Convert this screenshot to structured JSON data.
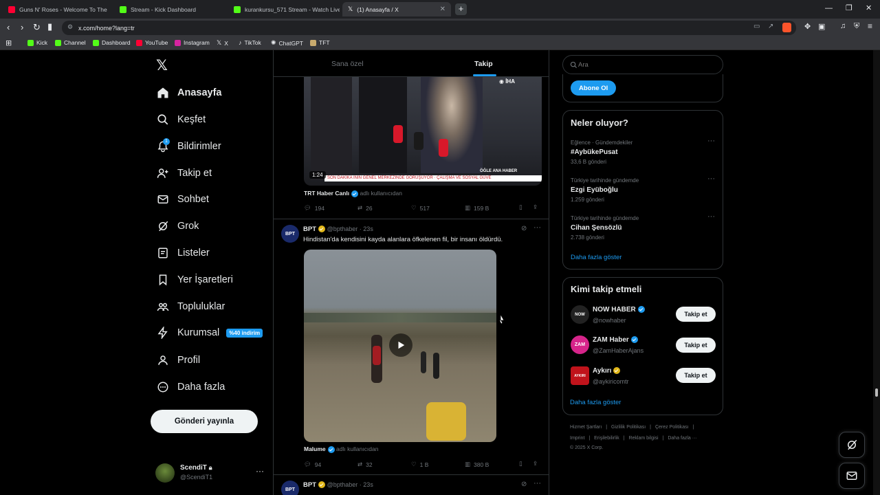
{
  "browser": {
    "tabs": [
      {
        "title": "Guns N' Roses - Welcome To The",
        "favicon_color": "#ff0033",
        "active": false
      },
      {
        "title": "Stream - Kick Dashboard",
        "favicon_color": "#53fc18",
        "active": false
      },
      {
        "title": "kurankursu_571 Stream - Watch Live",
        "favicon_color": "#53fc18",
        "active": false
      },
      {
        "title": "(1) Anasayfa / X",
        "favicon_color": "#ffffff",
        "active": true
      }
    ],
    "new_tab": "+",
    "url": "x.com/home?lang=tr",
    "bookmarks": [
      {
        "label": "Kick",
        "color": "#53fc18"
      },
      {
        "label": "Channel",
        "color": "#53fc18"
      },
      {
        "label": "Dashboard",
        "color": "#53fc18"
      },
      {
        "label": "YouTube",
        "color": "#ff0033"
      },
      {
        "label": "Instagram",
        "color": "#d6249f"
      },
      {
        "label": "X",
        "color": "#ffffff"
      },
      {
        "label": "TikTok",
        "color": "#25f4ee"
      },
      {
        "label": "ChatGPT",
        "color": "#cccccc"
      },
      {
        "label": "TFT",
        "color": "#c8aa6e"
      }
    ]
  },
  "sidebar": {
    "logo": "X",
    "items": [
      {
        "label": "Anasayfa",
        "icon": "home-icon"
      },
      {
        "label": "Keşfet",
        "icon": "search-icon"
      },
      {
        "label": "Bildirimler",
        "icon": "bell-icon",
        "count": "1"
      },
      {
        "label": "Takip et",
        "icon": "follow-icon"
      },
      {
        "label": "Sohbet",
        "icon": "mail-icon"
      },
      {
        "label": "Grok",
        "icon": "grok-icon"
      },
      {
        "label": "Listeler",
        "icon": "list-icon"
      },
      {
        "label": "Yer İşaretleri",
        "icon": "bookmark-icon"
      },
      {
        "label": "Topluluklar",
        "icon": "communities-icon"
      },
      {
        "label": "Kurumsal",
        "icon": "lightning-icon",
        "badge": "%40 indirim"
      },
      {
        "label": "Profil",
        "icon": "person-icon"
      },
      {
        "label": "Daha fazla",
        "icon": "more-circle-icon"
      }
    ],
    "post_button": "Gönderi yayınla",
    "account": {
      "name": "ScendiT",
      "handle": "@ScendiT1",
      "more": "···"
    }
  },
  "feed": {
    "tabs": [
      "Sana özel",
      "Takip"
    ],
    "active_tab": "Takip",
    "post1": {
      "duration": "1:24",
      "ticker": "SON DAKİKA ININ GENEL MERKEZİNDE GÖRÜŞÜYOR · ÇALIŞMA VE SOSYAL GÜVE",
      "overlay": "ÖĞLE ANA HABER",
      "source_name": "TRT Haber Canlı",
      "source_note": "adlı kullanıcıdan",
      "stats": {
        "replies": "194",
        "reposts": "26",
        "likes": "517",
        "views": "159 B"
      }
    },
    "post2": {
      "author": "BPT",
      "handle": "@bpthaber · 23s",
      "text": "Hindistan'da kendisini kayda alanlara öfkelenen fil, bir insanı öldürdü.",
      "source_name": "Malume",
      "source_note": "adlı kullanıcıdan",
      "stats": {
        "replies": "94",
        "reposts": "32",
        "likes": "1 B",
        "views": "380 B"
      }
    },
    "post3": {
      "author": "BPT",
      "handle": "@bpthaber · 23s"
    }
  },
  "right": {
    "search_placeholder": "Ara",
    "subscribe": "Abone Ol",
    "trends_title": "Neler oluyor?",
    "trends": [
      {
        "category": "Eğlence · Gündemdekiler",
        "title": "#AybükePusat",
        "count": "33,6 B gönderi"
      },
      {
        "category": "Türkiye tarihinde gündemde",
        "title": "Ezgi Eyüboğlu",
        "count": "1.259 gönderi"
      },
      {
        "category": "Türkiye tarihinde gündemde",
        "title": "Cihan Şensözlü",
        "count": "2.738 gönderi"
      }
    ],
    "trends_more": "Daha fazla göster",
    "who_title": "Kimi takip etmeli",
    "who": [
      {
        "name": "NOW HABER",
        "handle": "@nowhaber",
        "avatar": "NOW",
        "avatar_bg": "#222222",
        "button": "Takip et"
      },
      {
        "name": "ZAM Haber",
        "handle": "@ZamHaberAjans",
        "avatar": "ZAM",
        "avatar_bg": "#d6248a",
        "button": "Takip et"
      },
      {
        "name": "Aykırı",
        "handle": "@aykiricomtr",
        "avatar": "AYKIRI",
        "avatar_bg": "#c0131b",
        "button": "Takip et"
      }
    ],
    "who_more": "Daha fazla göster",
    "footer": {
      "line1": [
        "Hizmet Şartları",
        "Gizlilik Politikası",
        "Çerez Politikası"
      ],
      "line2": [
        "Imprint",
        "Erişilebilirlik",
        "Reklam bilgisi",
        "Daha fazla ···"
      ],
      "copyright": "© 2025 X Corp."
    }
  },
  "colors": {
    "accent": "#1d9bf0",
    "gold": "#e2b719",
    "border": "#2f3336"
  }
}
